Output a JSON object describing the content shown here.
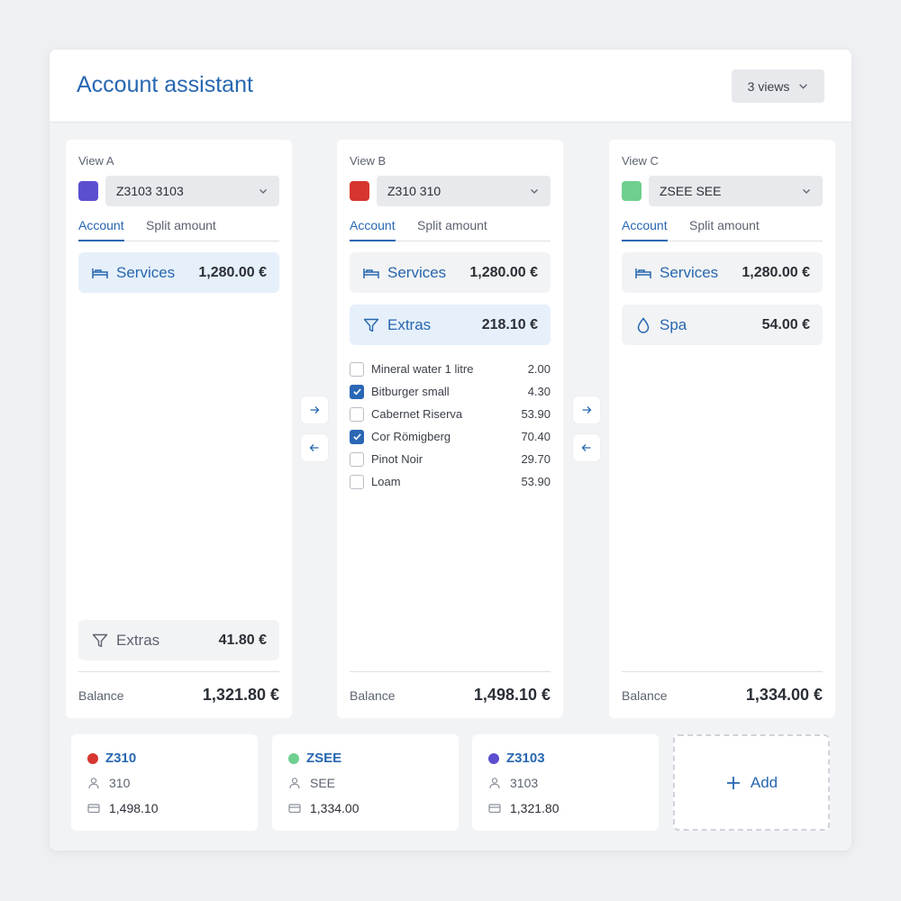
{
  "header": {
    "title": "Account assistant",
    "views_label": "3 views"
  },
  "colors": {
    "accent": "#2767b0",
    "purple": "#5b4fcf",
    "red": "#d6362f",
    "green": "#6ecf8e"
  },
  "panels": [
    {
      "label": "View A",
      "select": "Z3103 3103",
      "swatch": "purple",
      "tabs": [
        "Account",
        "Split amount"
      ],
      "categories": [
        {
          "icon": "bed-icon",
          "name": "Services",
          "amount": "1,280.00 €",
          "selected": true
        }
      ],
      "bottom_category": {
        "icon": "filter-icon",
        "name": "Extras",
        "amount": "41.80 €"
      },
      "balance_label": "Balance",
      "balance": "1,321.80 €"
    },
    {
      "label": "View B",
      "select": "Z310 310",
      "swatch": "red",
      "tabs": [
        "Account",
        "Split amount"
      ],
      "categories": [
        {
          "icon": "bed-icon",
          "name": "Services",
          "amount": "1,280.00 €",
          "selected": false
        },
        {
          "icon": "filter-icon",
          "name": "Extras",
          "amount": "218.10 €",
          "selected": true
        }
      ],
      "items": [
        {
          "name": "Mineral water 1 litre",
          "amount": "2.00",
          "checked": false
        },
        {
          "name": "Bitburger small",
          "amount": "4.30",
          "checked": true
        },
        {
          "name": "Cabernet Riserva",
          "amount": "53.90",
          "checked": false
        },
        {
          "name": "Cor Römigberg",
          "amount": "70.40",
          "checked": true
        },
        {
          "name": "Pinot Noir",
          "amount": "29.70",
          "checked": false
        },
        {
          "name": "Loam",
          "amount": "53.90",
          "checked": false
        }
      ],
      "balance_label": "Balance",
      "balance": "1,498.10 €"
    },
    {
      "label": "View C",
      "select": "ZSEE SEE",
      "swatch": "green",
      "tabs": [
        "Account",
        "Split amount"
      ],
      "categories": [
        {
          "icon": "bed-icon",
          "name": "Services",
          "amount": "1,280.00 €",
          "selected": false
        },
        {
          "icon": "drop-icon",
          "name": "Spa",
          "amount": "54.00 €",
          "selected": false
        }
      ],
      "balance_label": "Balance",
      "balance": "1,334.00 €"
    }
  ],
  "cards": [
    {
      "name": "Z310",
      "room": "310",
      "amount": "1,498.10",
      "color": "red"
    },
    {
      "name": "ZSEE",
      "room": "SEE",
      "amount": "1,334.00",
      "color": "green"
    },
    {
      "name": "Z3103",
      "room": "3103",
      "amount": "1,321.80",
      "color": "purple"
    }
  ],
  "add_label": "Add"
}
